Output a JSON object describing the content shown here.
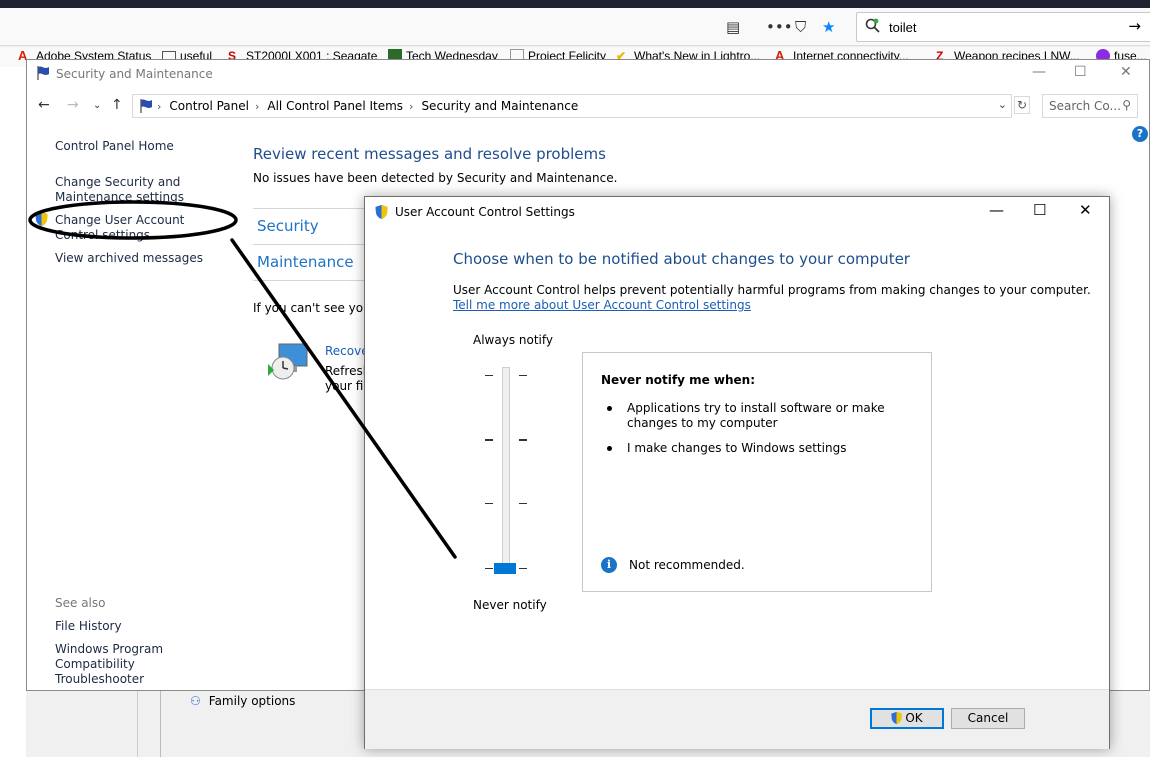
{
  "browser": {
    "search_text": "toilet",
    "bookmarks": [
      "Adobe System Status",
      "useful",
      "ST2000LX001 : Seagate",
      "Tech Wednesday",
      "Project Felicity",
      "What's New in Lightro...",
      "Internet connectivity...",
      "Weapon recipes LNW...",
      "fuse..."
    ]
  },
  "control_panel": {
    "title": "Security and Maintenance",
    "breadcrumbs": [
      "Control Panel",
      "All Control Panel Items",
      "Security and Maintenance"
    ],
    "search_placeholder": "Search Co...",
    "sidebar": {
      "home": "Control Panel Home",
      "change_security": "Change Security and Maintenance settings",
      "change_uac": "Change User Account Control settings",
      "view_archived": "View archived messages",
      "see_also": "See also",
      "file_history": "File History",
      "compat_troubleshooter": "Windows Program Compatibility Troubleshooter"
    },
    "main": {
      "heading": "Review recent messages and resolve problems",
      "status": "No issues have been detected by Security and Maintenance.",
      "section_security": "Security",
      "section_maintenance": "Maintenance",
      "cant_see": "If you can't see your p",
      "recovery_link": "Recover",
      "recovery_line1": "Refresh",
      "recovery_line2": "your file"
    },
    "family_options": "Family options"
  },
  "uac_dialog": {
    "title": "User Account Control Settings",
    "heading": "Choose when to be notified about changes to your computer",
    "description": "User Account Control helps prevent potentially harmful programs from making changes to your computer.",
    "learn_more": "Tell me more about User Account Control settings",
    "slider_top": "Always notify",
    "slider_bottom": "Never notify",
    "slider_level": 0,
    "slider_levels_total": 4,
    "info_heading": "Never notify me when:",
    "info_items": [
      "Applications try to install software or make changes to my computer",
      "I make changes to Windows settings"
    ],
    "warning": "Not recommended.",
    "ok_label": "OK",
    "cancel_label": "Cancel"
  },
  "colors": {
    "accent": "#0078d7",
    "heading_blue": "#1e4e8c",
    "link_blue": "#1a5fb4"
  }
}
